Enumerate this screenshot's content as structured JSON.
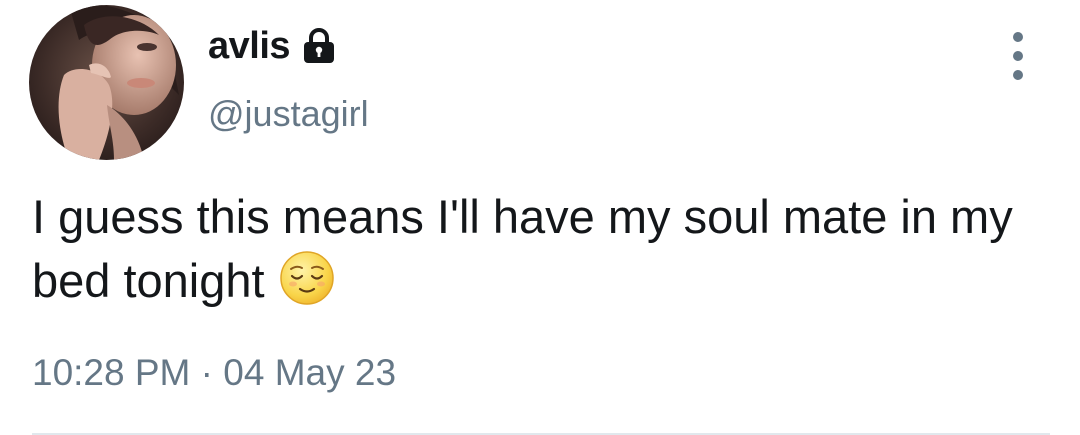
{
  "tweet": {
    "display_name": "avlis",
    "handle": "@justagirl",
    "text": "I guess this means I'll have my soul mate in my bed tonight",
    "emoji": "relieved-face",
    "time": "10:28 PM",
    "separator": "·",
    "date": "04 May 23"
  },
  "icons": {
    "lock": "lock-icon",
    "more": "more-vertical-icon"
  },
  "colors": {
    "text_primary": "#14171a",
    "text_secondary": "#657786",
    "divider": "#e1e8ed"
  }
}
